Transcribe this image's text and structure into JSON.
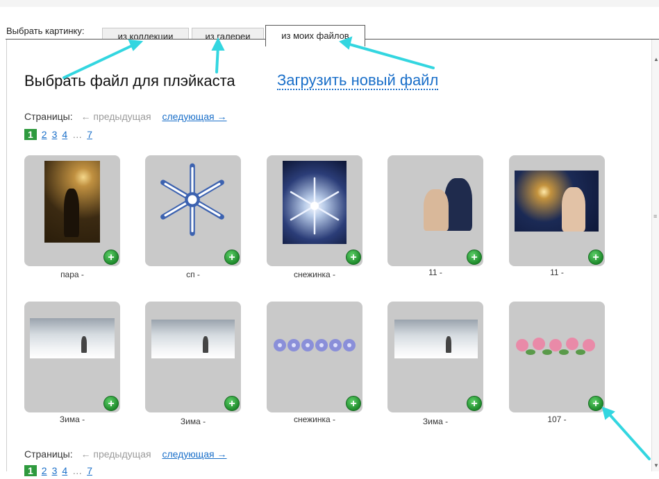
{
  "header": {
    "choose_label": "Выбрать картинку:",
    "tabs": [
      {
        "label": "из коллекции",
        "active": false
      },
      {
        "label": "из галереи",
        "active": false
      },
      {
        "label": "из моих файлов",
        "active": true
      }
    ]
  },
  "main": {
    "title": "Выбрать файл для плэйкаста",
    "upload_link": "Загрузить новый файл"
  },
  "pager": {
    "label": "Страницы:",
    "prev": "← предыдущая",
    "next": "следующая →",
    "pages": [
      "1",
      "2",
      "3",
      "4",
      "…",
      "7"
    ],
    "current": "1"
  },
  "items": [
    {
      "caption": "пара -",
      "image": "couple-night"
    },
    {
      "caption": "сп -",
      "image": "snowflake"
    },
    {
      "caption": "снежинка -",
      "image": "snowflake-blue"
    },
    {
      "caption": "11 -",
      "image": "couple"
    },
    {
      "caption": "11 -",
      "image": "couple-lights"
    },
    {
      "caption": "Зима -",
      "image": "winter-landscape"
    },
    {
      "caption": "Зима -",
      "image": "winter-landscape"
    },
    {
      "caption": "снежинка -",
      "image": "snowflake-row"
    },
    {
      "caption": "Зима -",
      "image": "winter-landscape"
    },
    {
      "caption": "107 -",
      "image": "flower-row"
    }
  ],
  "add_button_symbol": "+",
  "colors": {
    "accent": "#2e9a3e",
    "link": "#1a6fc9",
    "arrow": "#33d6e0"
  }
}
